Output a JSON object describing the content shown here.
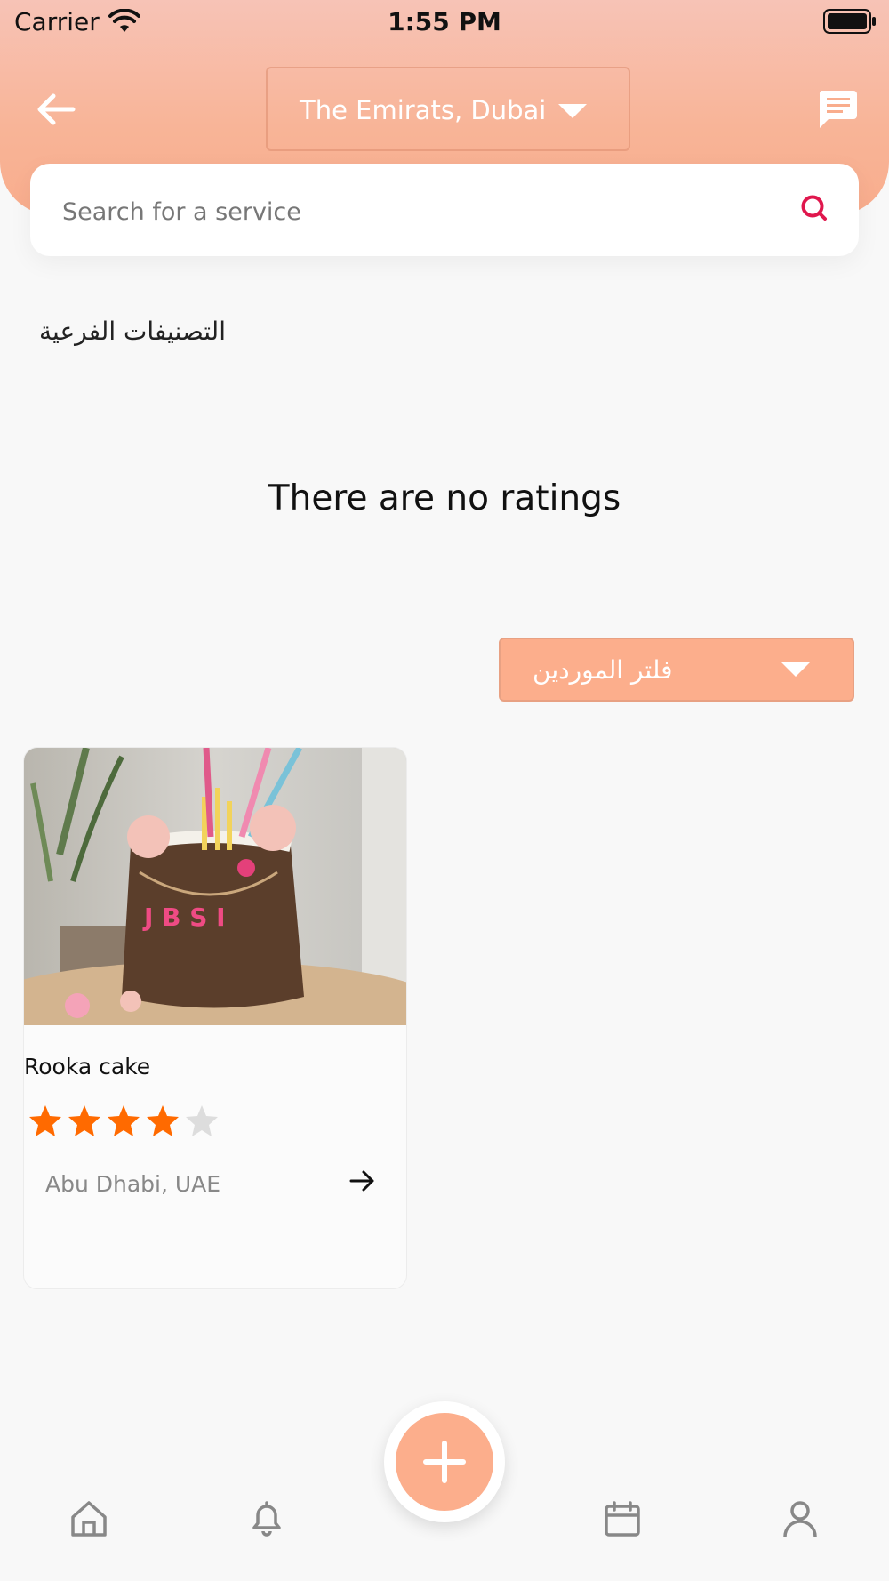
{
  "status_bar": {
    "carrier": "Carrier",
    "time": "1:55 PM"
  },
  "header": {
    "location": "The Emirats, Dubai"
  },
  "search": {
    "placeholder": "Search for a service"
  },
  "subcategories_title": "التصنيفات الفرعية",
  "empty_ratings_message": "There are no ratings",
  "filter": {
    "label": "فلتر الموردين"
  },
  "vendors": [
    {
      "name": "Rooka cake",
      "location": "Abu Dhabi, UAE",
      "rating": 4,
      "max_rating": 5
    }
  ],
  "colors": {
    "accent": "#fcae8c",
    "star_filled": "#ff6a00",
    "star_empty": "#dddddd",
    "search_icon": "#e0174d"
  },
  "icons": {
    "header": [
      "back-arrow-icon",
      "chevron-down-icon",
      "message-icon"
    ],
    "search": "search-icon",
    "card": "arrow-right-icon",
    "nav": [
      "home-icon",
      "bell-icon",
      "plus-icon",
      "calendar-icon",
      "user-icon"
    ]
  }
}
